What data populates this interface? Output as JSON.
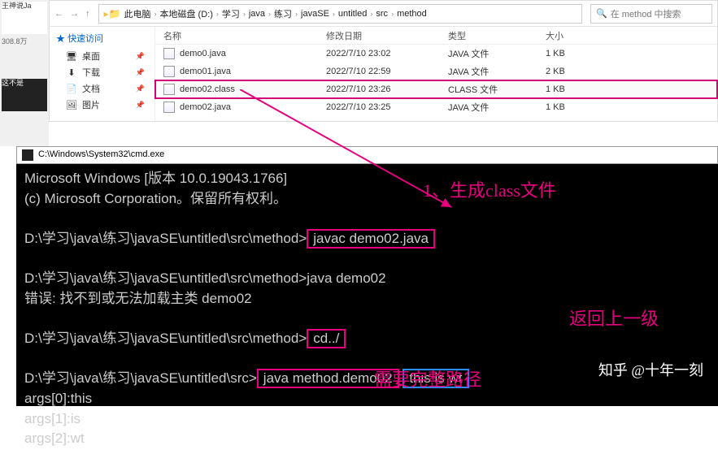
{
  "left_strip": {
    "title": "王神说Ja",
    "sub": "308.8万",
    "caption": "这不是"
  },
  "explorer": {
    "breadcrumb": [
      "此电脑",
      "本地磁盘 (D:)",
      "学习",
      "java",
      "练习",
      "javaSE",
      "untitled",
      "src",
      "method"
    ],
    "search_placeholder": "在 method 中搜索",
    "nav_group": "快速访问",
    "nav_items": [
      {
        "icon": "🖥",
        "label": "桌面"
      },
      {
        "icon": "⬇",
        "label": "下载"
      },
      {
        "icon": "📄",
        "label": "文档"
      },
      {
        "icon": "🖼",
        "label": "图片"
      }
    ],
    "columns": {
      "name": "名称",
      "date": "修改日期",
      "type": "类型",
      "size": "大小"
    },
    "files": [
      {
        "name": "demo0.java",
        "date": "2022/7/10 23:02",
        "type": "JAVA 文件",
        "size": "1 KB",
        "selected": false
      },
      {
        "name": "demo01.java",
        "date": "2022/7/10 22:59",
        "type": "JAVA 文件",
        "size": "2 KB",
        "selected": false
      },
      {
        "name": "demo02.class",
        "date": "2022/7/10 23:26",
        "type": "CLASS 文件",
        "size": "1 KB",
        "selected": true
      },
      {
        "name": "demo02.java",
        "date": "2022/7/10 23:25",
        "type": "JAVA 文件",
        "size": "1 KB",
        "selected": false
      }
    ]
  },
  "cmd": {
    "title": "C:\\Windows\\System32\\cmd.exe",
    "line_ver1": "Microsoft Windows [版本 10.0.19043.1766]",
    "line_ver2": "(c) Microsoft Corporation。保留所有权利。",
    "prompt_long": "D:\\学习\\java\\练习\\javaSE\\untitled\\src\\method>",
    "prompt_short": "D:\\学习\\java\\练习\\javaSE\\untitled\\src>",
    "cmd_compile": "javac demo02.java",
    "cmd_run1": "java demo02",
    "err_line": "错误: 找不到或无法加载主类 demo02",
    "cmd_cd": "cd../",
    "cmd_run2": "java method.demo02",
    "output_tail": "this is wt",
    "args": [
      "args[0]:this",
      "args[1]:is",
      "args[2]:wt"
    ]
  },
  "annotations": {
    "a1": "1、生成class文件",
    "a2": "返回上一级",
    "a3": "需要完整路径",
    "attrib": "知乎 @十年一刻"
  }
}
